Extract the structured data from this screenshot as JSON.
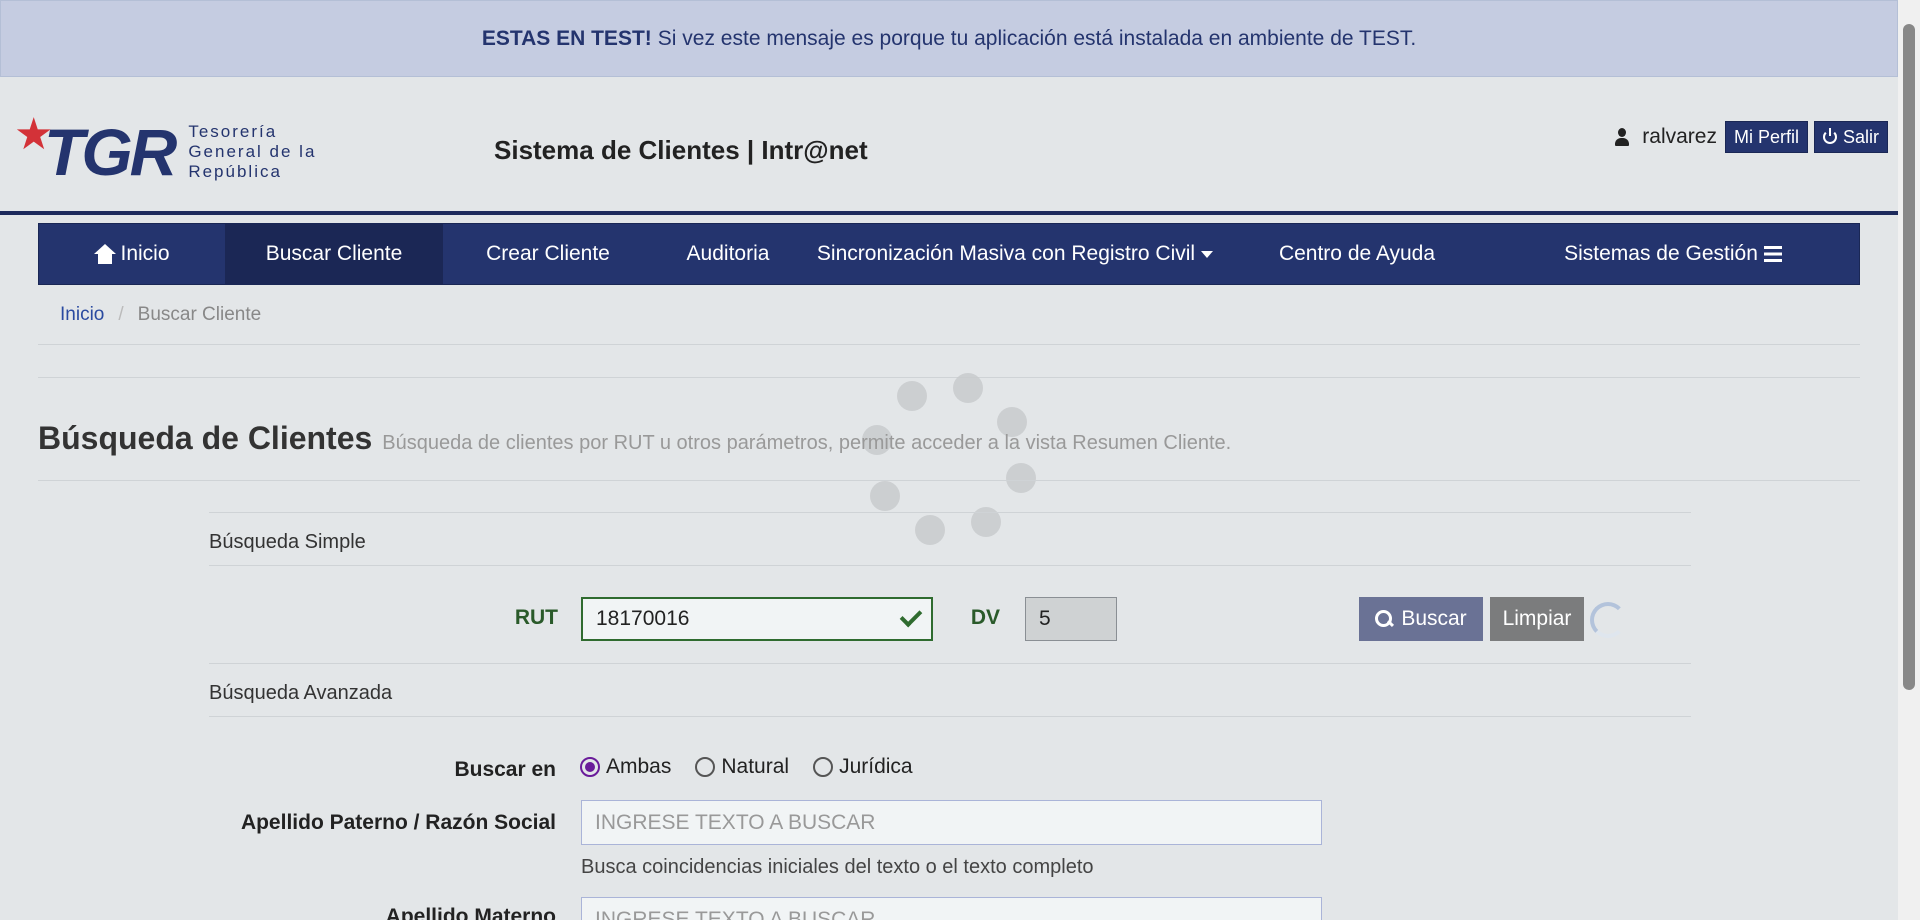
{
  "banner": {
    "bold": "ESTAS EN TEST!",
    "text": "Si vez este mensaje es porque tu aplicación está instalada en ambiente de TEST."
  },
  "header": {
    "logo_mark": "TGR",
    "logo_lines": [
      "Tesorería",
      "General de la",
      "República"
    ],
    "app_title": "Sistema de Clientes | Intr@net",
    "username": "ralvarez",
    "profile_label": "Mi Perfil",
    "logout_label": "Salir"
  },
  "nav": {
    "items": [
      {
        "label": "Inicio",
        "icon": "home-icon"
      },
      {
        "label": "Buscar Cliente"
      },
      {
        "label": "Crear Cliente"
      },
      {
        "label": "Auditoria"
      },
      {
        "label": "Sincronización Masiva con Registro Civil",
        "icon": "caret-down-icon"
      },
      {
        "label": "Centro de Ayuda"
      },
      {
        "label": "Sistemas de Gestión",
        "icon": "menu-icon"
      }
    ],
    "active_index": 1
  },
  "breadcrumb": {
    "home": "Inicio",
    "separator": "/",
    "current": "Buscar Cliente"
  },
  "page": {
    "title": "Búsqueda de Clientes",
    "description": "Búsqueda de clientes por RUT u otros parámetros, permite acceder a la vista Resumen Cliente."
  },
  "simple_search": {
    "section_label": "Búsqueda Simple",
    "rut_label": "RUT",
    "rut_value": "18170016",
    "dv_label": "DV",
    "dv_value": "5",
    "search_button": "Buscar",
    "clear_button": "Limpiar"
  },
  "advanced_search": {
    "section_label": "Búsqueda Avanzada",
    "search_in_label": "Buscar en",
    "options": [
      "Ambas",
      "Natural",
      "Jurídica"
    ],
    "selected_option": "Ambas",
    "surname_label": "Apellido Paterno / Razón Social",
    "surname_placeholder": "INGRESE TEXTO A BUSCAR",
    "surname_help": "Busca coincidencias iniciales del texto o el texto completo",
    "mother_surname_label": "Apellido Materno",
    "mother_surname_placeholder": "INGRESE TEXTO A BUSCAR"
  },
  "colors": {
    "brand_navy": "#24346e",
    "logo_red": "#d33238",
    "valid_green": "#2f6b2f",
    "radio_purple": "#6a1b9a"
  }
}
